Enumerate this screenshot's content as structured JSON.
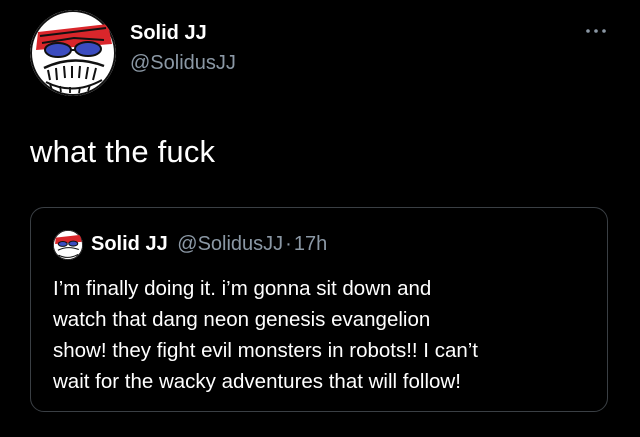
{
  "tweet": {
    "author": {
      "display_name": "Solid JJ",
      "handle": "@SolidusJJ"
    },
    "text": "what the fuck",
    "more_icon": "more-horizontal-icon"
  },
  "quoted_tweet": {
    "author": {
      "display_name": "Solid JJ",
      "handle": "@SolidusJJ"
    },
    "separator": "·",
    "time": "17h",
    "text_lines": [
      "I’m finally doing it. i’m gonna sit down and",
      "watch that dang neon genesis evangelion",
      "show! they fight evil monsters in robots!! I can’t",
      "wait for the wacky adventures that will follow!"
    ]
  },
  "colors": {
    "background": "#000000",
    "text_primary": "#ffffff",
    "text_secondary": "#8b98a5",
    "card_border": "#3a3f44"
  }
}
